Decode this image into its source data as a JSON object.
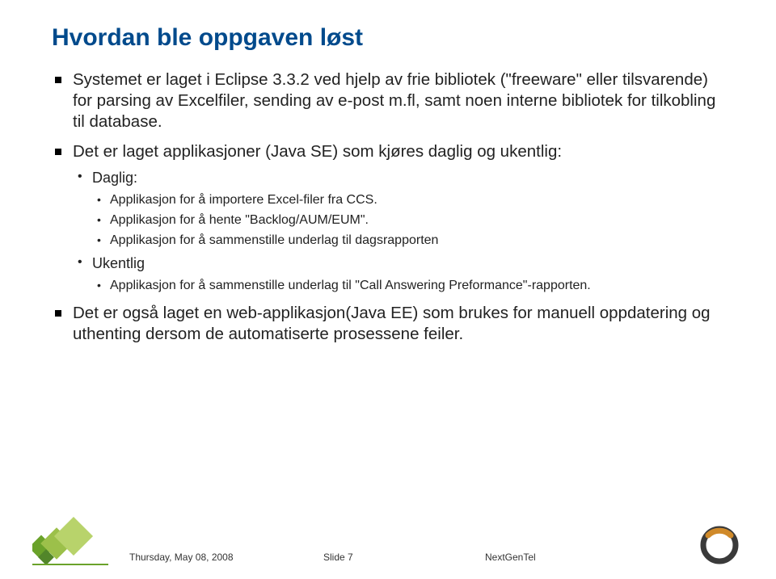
{
  "title": "Hvordan ble oppgaven løst",
  "bullets": {
    "b1": "Systemet er laget i Eclipse 3.3.2 ved hjelp av frie bibliotek (\"freeware\" eller tilsvarende) for parsing av Excelfiler, sending av e-post m.fl, samt noen interne bibliotek for tilkobling til database.",
    "b2": "Det er laget applikasjoner (Java SE) som kjøres daglig og ukentlig:",
    "b2_daglig": "Daglig:",
    "b2_daglig_1": "Applikasjon for å importere Excel-filer fra CCS.",
    "b2_daglig_2": "Applikasjon for å hente \"Backlog/AUM/EUM\".",
    "b2_daglig_3": "Applikasjon for å sammenstille underlag til dagsrapporten",
    "b2_ukentlig": "Ukentlig",
    "b2_ukentlig_1": "Applikasjon for å sammenstille underlag til \"Call Answering Preformance\"-rapporten.",
    "b3": "Det er også laget en web-applikasjon(Java EE) som brukes for manuell oppdatering og uthenting dersom de automatiserte prosessene feiler."
  },
  "footer": {
    "date": "Thursday, May 08, 2008",
    "slidenum": "Slide 7",
    "brand": "NextGenTel"
  }
}
